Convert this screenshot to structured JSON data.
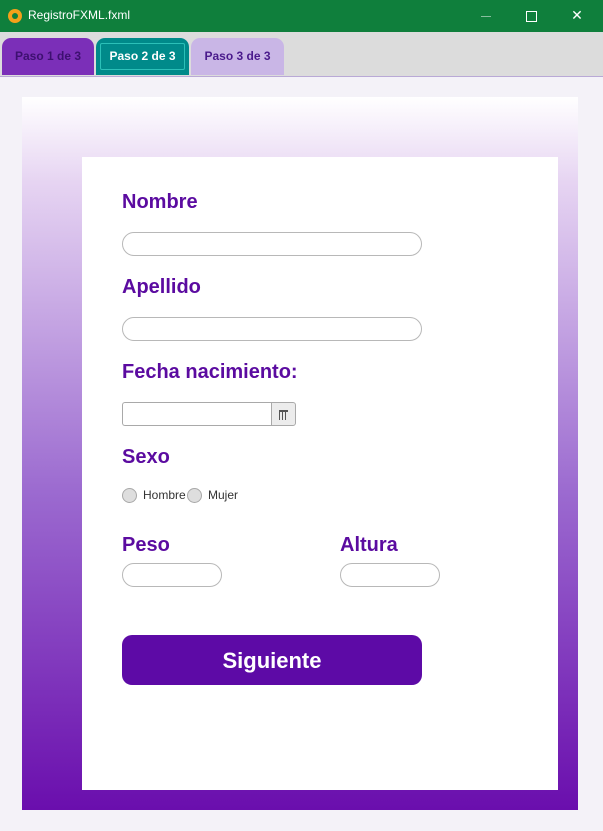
{
  "window": {
    "title": "RegistroFXML.fxml",
    "icon": "app-icon"
  },
  "tabs": [
    {
      "label": "Paso 1 de 3",
      "active": false
    },
    {
      "label": "Paso 2 de 3",
      "active": true
    },
    {
      "label": "Paso 3 de 3",
      "active": false
    }
  ],
  "form": {
    "nombre_label": "Nombre",
    "nombre_value": "",
    "apellido_label": "Apellido",
    "apellido_value": "",
    "fecha_label": "Fecha nacimiento:",
    "fecha_value": "",
    "sexo_label": "Sexo",
    "sexo_options": [
      "Hombre",
      "Mujer"
    ],
    "peso_label": "Peso",
    "peso_value": "",
    "altura_label": "Altura",
    "altura_value": "",
    "next_label": "Siguiente"
  },
  "colors": {
    "titlebar": "#0f7f3c",
    "accent_purple": "#5d0aa6",
    "tab_active": "#008a8a",
    "label_purple": "#5b0ba0"
  }
}
